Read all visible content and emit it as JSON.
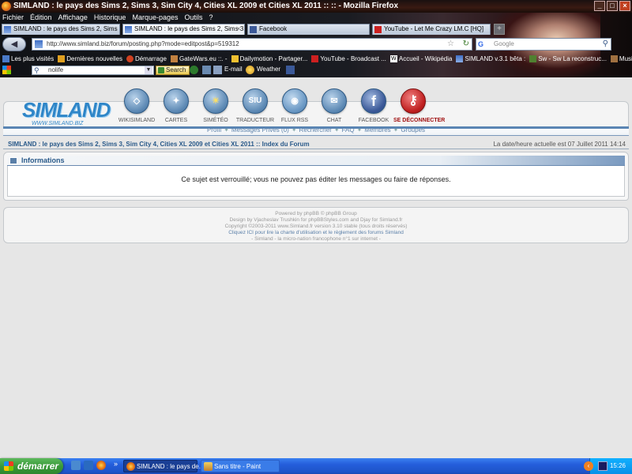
{
  "window": {
    "title": "SIMLAND : le pays des Sims 2, Sims 3, Sim City 4, Cities XL 2009 et Cities XL 2011 :: :: - Mozilla Firefox"
  },
  "menu": [
    "Fichier",
    "Édition",
    "Affichage",
    "Historique",
    "Marque-pages",
    "Outils",
    "?"
  ],
  "tabs": [
    {
      "label": "SIMLAND : le pays des Sims 2, Sims 3, Si...",
      "active": false
    },
    {
      "label": "SIMLAND : le pays des Sims 2, Sims 3, Si...",
      "active": true
    },
    {
      "label": "Facebook",
      "active": false
    },
    {
      "label": "YouTube - Let Me Crazy LM.C [HQ]",
      "active": false
    }
  ],
  "navbar": {
    "url": "http://www.simland.biz/forum/posting.php?mode=editpost&p=519312",
    "search_placeholder": "Google"
  },
  "bookmarks": [
    "Les plus visités",
    "Dernières nouvelles",
    "Démarrage",
    "GateWars.eu ::. -",
    "Dailymotion - Partager...",
    "YouTube - Broadcast ...",
    "Accueil - Wikipédia",
    "SIMLAND v.3.1 bêta :",
    "Sw - Sw La reconstruc...",
    "Musique à la demande..."
  ],
  "toolbar": {
    "search_value": "nolife",
    "search_button": "Search",
    "email": "E-mail",
    "weather": "Weather"
  },
  "logo": {
    "text": "SIMLAND",
    "sub": "WWW.SIMLAND.BIZ"
  },
  "nav_icons": [
    {
      "label": "WIKISIMLAND",
      "glyph": "◇"
    },
    {
      "label": "CARTES",
      "glyph": "✦"
    },
    {
      "label": "SIMÉTÉO",
      "glyph": "☀"
    },
    {
      "label": "TRADUCTEUR",
      "glyph": "SIU"
    },
    {
      "label": "FLUX RSS",
      "glyph": "◉"
    },
    {
      "label": "CHAT",
      "glyph": "✉"
    },
    {
      "label": "FACEBOOK",
      "glyph": "f"
    },
    {
      "label": "SE DÉCONNECTER",
      "glyph": "⚷"
    }
  ],
  "links": [
    "Profil",
    "Messages Privés (0)",
    "Rechercher",
    "FAQ",
    "Membres",
    "Groupes"
  ],
  "breadcrumb": "SIMLAND : le pays des Sims 2, Sims 3, Sim City 4, Cities XL 2009 et Cities XL 2011 :: Index du Forum",
  "datetime": "La date/heure actuelle est 07 Juillet 2011 14:14",
  "info": {
    "title": "Informations",
    "message": "Ce sujet est verrouillé; vous ne pouvez pas éditer les messages ou faire de réponses."
  },
  "footer": {
    "line1": "Powered by phpBB © phpBB Group",
    "line2": "Design by Vjacheslav Trushkin for phpBBStyles.com and Djay for Simland.fr",
    "line3": "Copyright ©2003-2011 www.Simland.fr version 3.10 stable (tous droits réservés)",
    "line4": "Cliquez ICI pour lire la charte d'utilisation et le règlement des forums Simland",
    "line5": "- Simland - la micro-nation francophone n°1 sur internet -"
  },
  "taskbar": {
    "start": "démarrer",
    "tasks": [
      {
        "label": "SIMLAND : le pays de...",
        "active": true
      },
      {
        "label": "Sans titre - Paint",
        "active": false
      }
    ],
    "clock": "15:26"
  },
  "colors": {
    "accent": "#2a5a8a",
    "link": "#5a7fa8",
    "logout": "#a01010",
    "taskbar": "#245edb",
    "start": "#3a9a3a"
  }
}
